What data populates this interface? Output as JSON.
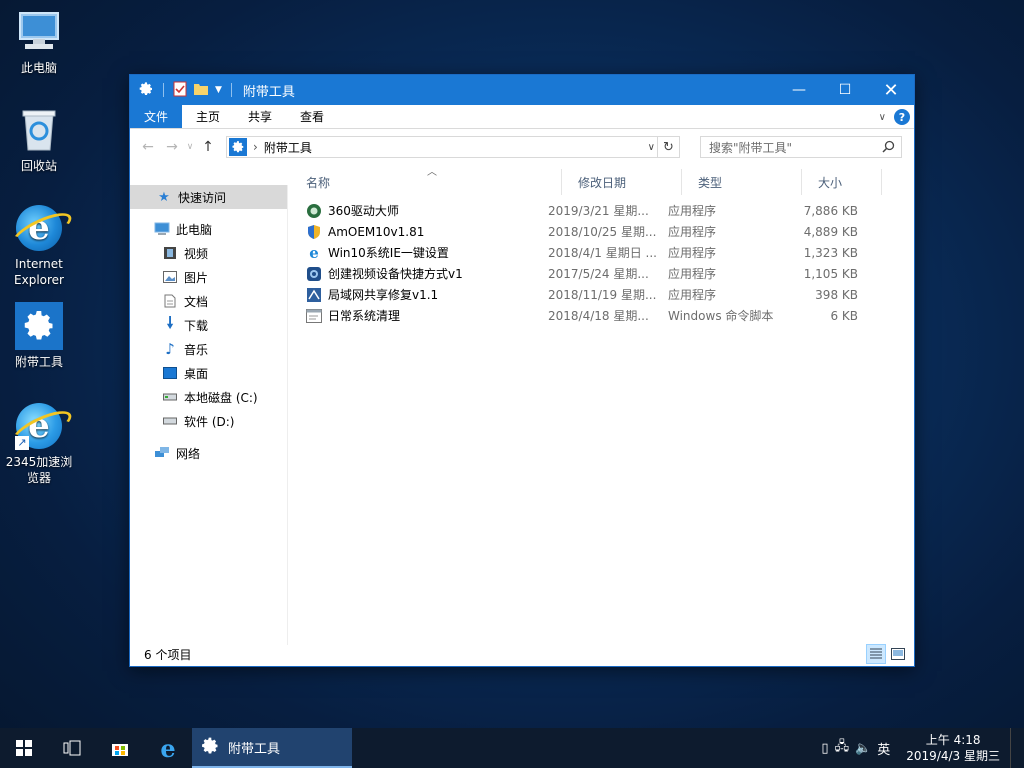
{
  "desktop": {
    "icons": [
      {
        "label": "此电脑"
      },
      {
        "label": "回收站"
      },
      {
        "label": "Internet Explorer"
      },
      {
        "label": "附带工具"
      },
      {
        "label": "2345加速浏览器"
      }
    ]
  },
  "window": {
    "title": "附带工具",
    "ribbon_tabs": [
      "文件",
      "主页",
      "共享",
      "查看"
    ],
    "address_path": "附带工具",
    "search_placeholder": "搜索\"附带工具\"",
    "columns": {
      "name": "名称",
      "date": "修改日期",
      "type": "类型",
      "size": "大小"
    },
    "nav": {
      "quick_access": "快速访问",
      "this_pc": "此电脑",
      "videos": "视频",
      "pictures": "图片",
      "documents": "文档",
      "downloads": "下载",
      "music": "音乐",
      "desktop": "桌面",
      "local_disk_c": "本地磁盘 (C:)",
      "software_d": "软件 (D:)",
      "network": "网络"
    },
    "files": [
      {
        "name": "360驱动大师",
        "date": "2019/3/21 星期...",
        "type": "应用程序",
        "size": "7,886 KB",
        "icon": "driver-app-icon"
      },
      {
        "name": "AmOEM10v1.81",
        "date": "2018/10/25 星期...",
        "type": "应用程序",
        "size": "4,889 KB",
        "icon": "shield-app-icon"
      },
      {
        "name": "Win10系统IE一键设置",
        "date": "2018/4/1 星期日 ...",
        "type": "应用程序",
        "size": "1,323 KB",
        "icon": "ie-app-icon"
      },
      {
        "name": "创建视频设备快捷方式v1",
        "date": "2017/5/24 星期...",
        "type": "应用程序",
        "size": "1,105 KB",
        "icon": "camera-app-icon"
      },
      {
        "name": "局域网共享修复v1.1",
        "date": "2018/11/19 星期...",
        "type": "应用程序",
        "size": "398 KB",
        "icon": "network-app-icon"
      },
      {
        "name": "日常系统清理",
        "date": "2018/4/18 星期...",
        "type": "Windows 命令脚本",
        "size": "6 KB",
        "icon": "script-file-icon"
      }
    ],
    "status": "6 个项目"
  },
  "taskbar": {
    "active_app": "附带工具",
    "ime": "英",
    "time": "上午 4:18",
    "date": "2019/4/3 星期三"
  },
  "colors": {
    "accent": "#1a78d4",
    "taskbar": "#0d1b2e"
  }
}
